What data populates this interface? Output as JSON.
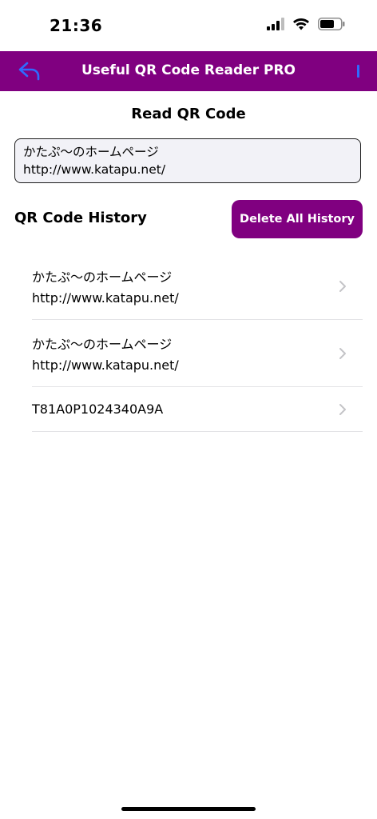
{
  "status_bar": {
    "time": "21:36"
  },
  "nav": {
    "title": "Useful QR Code Reader PRO",
    "accent_color": "#800080",
    "back_icon": "back-arrow-icon",
    "menu_icon": "menu-icon"
  },
  "read_section": {
    "title": "Read QR Code",
    "result_line1": "かたぷ〜のホームページ",
    "result_line2": "http://www.katapu.net/"
  },
  "history": {
    "title": "QR Code History",
    "delete_label": "Delete All History",
    "items": [
      {
        "line1": "かたぷ〜のホームページ",
        "line2": "http://www.katapu.net/"
      },
      {
        "line1": "かたぷ〜のホームページ",
        "line2": "http://www.katapu.net/"
      },
      {
        "line1": "T81A0P1024340A9A"
      }
    ]
  }
}
